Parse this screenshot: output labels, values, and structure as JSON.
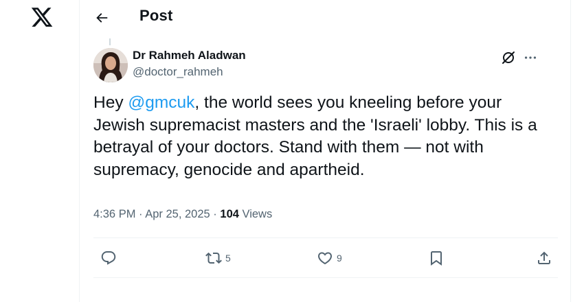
{
  "nav": {
    "logo": "x-logo-icon"
  },
  "header": {
    "title": "Post",
    "back_icon": "arrow-left-icon"
  },
  "author": {
    "name": "Dr Rahmeh Aladwan",
    "handle": "@doctor_rahmeh"
  },
  "post": {
    "text_before": "Hey ",
    "mention": "@gmcuk",
    "text_after": ", the world sees you kneeling before your Jewish supremacist masters and the 'Israeli' lobby. This is a betrayal of your doctors. Stand with them — not with supremacy, genocide and apartheid."
  },
  "meta": {
    "time": "4:36 PM",
    "sep1": " · ",
    "date": "Apr 25, 2025",
    "sep2": " · ",
    "views_count": "104",
    "views_label": " Views"
  },
  "actions": {
    "reply": {
      "icon": "reply-icon",
      "count": ""
    },
    "repost": {
      "icon": "repost-icon",
      "count": "5"
    },
    "like": {
      "icon": "heart-icon",
      "count": "9"
    },
    "bookmark": {
      "icon": "bookmark-icon",
      "count": ""
    },
    "share": {
      "icon": "share-icon",
      "count": ""
    }
  },
  "colors": {
    "text": "#0f1419",
    "secondary": "#536471",
    "accent": "#1d9bf0",
    "border": "#eff3f4"
  }
}
